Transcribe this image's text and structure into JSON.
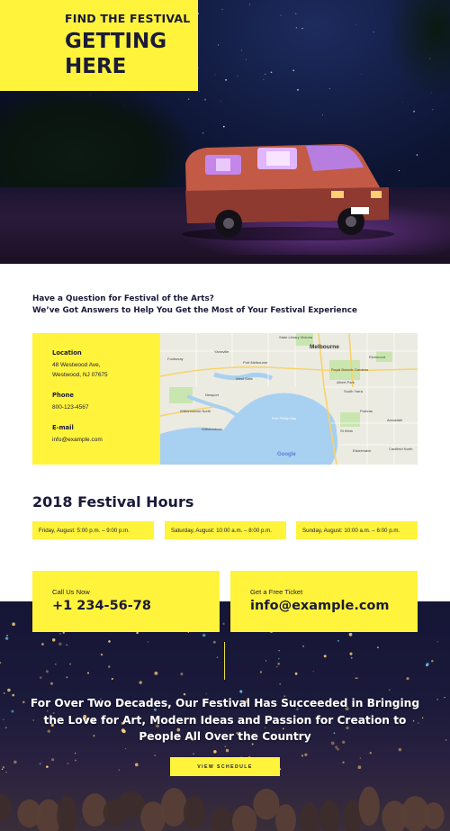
{
  "hero": {
    "kicker": "FIND THE FESTIVAL",
    "headline_line1": "GETTING",
    "headline_line2": "HERE"
  },
  "question": {
    "line1": "Have a Question for Festival of the Arts?",
    "line2": "We’ve Got Answers to Help You Get the Most of Your Festival Experience"
  },
  "contact": {
    "location_label": "Location",
    "address_line1": "48 Westwood Ave,",
    "address_line2": "Westwood, NJ 07675",
    "phone_label": "Phone",
    "phone": "800-123-4567",
    "email_label": "E-mail",
    "email": "info@example.com"
  },
  "map": {
    "labels": {
      "melbourne": "Melbourne",
      "state_library": "State Library Victoria",
      "port_melbourne": "Port Melbourne",
      "west_gate": "West Gate",
      "williamstown": "Williamstown",
      "williamstown_north": "Williamstown North",
      "newport": "Newport",
      "yarraville": "Yarraville",
      "footscray": "Footscray",
      "albert_park": "Albert Park",
      "south_yarra": "South Yarra",
      "prahran": "Prahran",
      "st_kilda": "St Kilda",
      "elsternwick": "Elsternwick",
      "caulfield": "Caulfield North",
      "armadale": "Armadale",
      "richmond": "Richmond",
      "royal_botanic": "Royal Botanic Gardens",
      "port_phillip": "Port Phillip Bay",
      "google": "Google"
    },
    "colors": {
      "water": "#a8d0f0",
      "land": "#ecebe2",
      "park": "#c9e6b0",
      "road": "#f8d36a"
    }
  },
  "hours": {
    "title": "2018 Festival Hours",
    "items": [
      "Friday, August: 5:00 p.m. – 9:00 p.m.",
      "Saturday, August: 10:00 a.m. – 8:00 p.m.",
      "Sunday, August: 10:00 a.m. – 6:00 p.m."
    ]
  },
  "cta": {
    "call_label": "Call Us Now",
    "phone": "+1 234-56-78",
    "ticket_label": "Get a Free Ticket",
    "email": "info@example.com"
  },
  "mission": {
    "text": "For Over Two Decades, Our Festival Has Succeeded in Bringing the Love for Art, Modern Ideas and Passion for Creation to People All Over the Country",
    "button": "VIEW SCHEDULE"
  },
  "colors": {
    "accent": "#fff33b",
    "ink": "#1a1a3a",
    "night": "#151536"
  }
}
